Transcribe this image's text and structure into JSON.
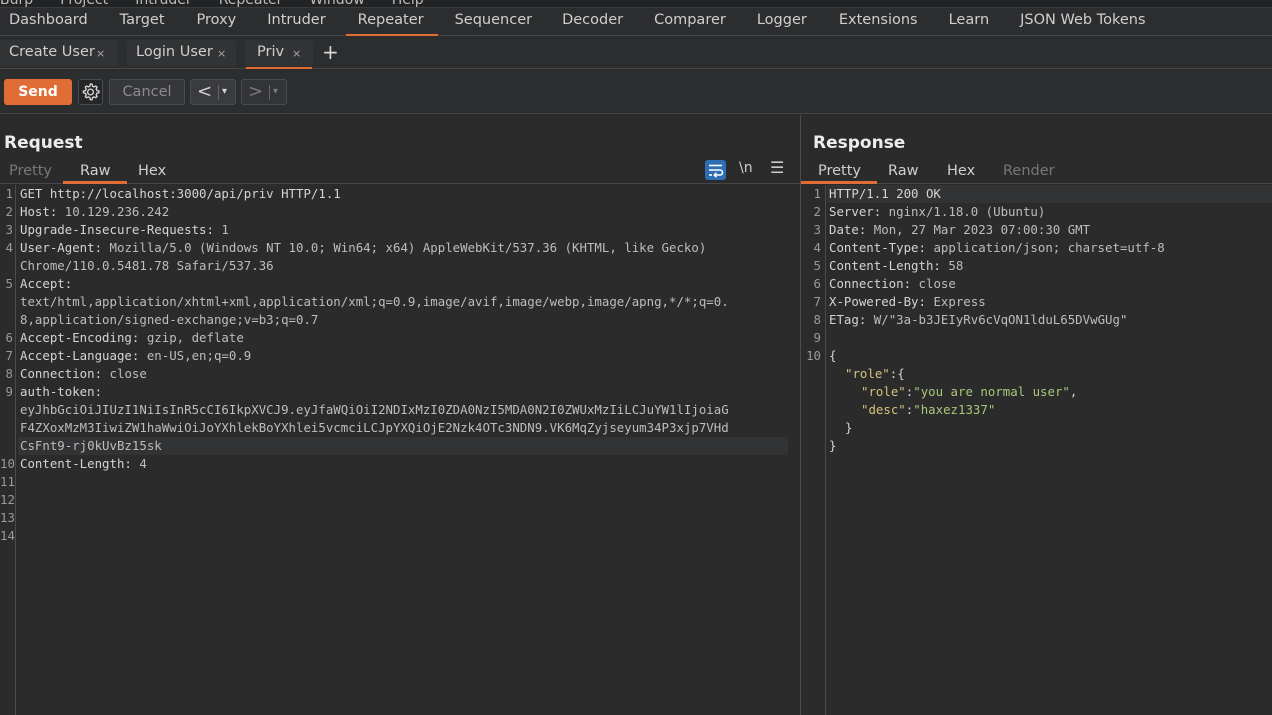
{
  "menubar": {
    "items": [
      "Burp",
      "Project",
      "Intruder",
      "Repeater",
      "Window",
      "Help"
    ]
  },
  "main_tabs": [
    {
      "label": "Dashboard",
      "active": false
    },
    {
      "label": "Target",
      "active": false
    },
    {
      "label": "Proxy",
      "active": false
    },
    {
      "label": "Intruder",
      "active": false
    },
    {
      "label": "Repeater",
      "active": true
    },
    {
      "label": "Sequencer",
      "active": false
    },
    {
      "label": "Decoder",
      "active": false
    },
    {
      "label": "Comparer",
      "active": false
    },
    {
      "label": "Logger",
      "active": false
    },
    {
      "label": "Extensions",
      "active": false
    },
    {
      "label": "Learn",
      "active": false
    },
    {
      "label": "JSON Web Tokens",
      "active": false
    }
  ],
  "repeater_tabs": [
    {
      "label": "Create User",
      "close": "×",
      "active": false
    },
    {
      "label": "Login User",
      "close": "×",
      "active": false
    },
    {
      "label": "Priv",
      "close": "×",
      "active": true
    }
  ],
  "add_tab_label": "+",
  "toolbar": {
    "send_label": "Send",
    "cancel_label": "Cancel",
    "settings_icon": "gear-icon",
    "prev_label": "<",
    "next_label": ">",
    "dropdown_glyph": "▾"
  },
  "request": {
    "title": "Request",
    "tabs": [
      {
        "label": "Pretty",
        "state": "disabled"
      },
      {
        "label": "Raw",
        "state": "active"
      },
      {
        "label": "Hex",
        "state": "normal"
      }
    ],
    "tools": {
      "wrap_icon": "word-wrap-icon",
      "newline_label": "\\n",
      "menu_icon": "hamburger-menu-icon"
    },
    "lines": [
      {
        "n": "1",
        "text": "GET http://localhost:3000/api/priv HTTP/1.1"
      },
      {
        "n": "2",
        "key": "Host:",
        "val": " 10.129.236.242"
      },
      {
        "n": "3",
        "key": "Upgrade-Insecure-Requests:",
        "val": " 1"
      },
      {
        "n": "4",
        "key": "User-Agent:",
        "val": " Mozilla/5.0 (Windows NT 10.0; Win64; x64) AppleWebKit/537.36 (KHTML, like Gecko)"
      },
      {
        "n": "",
        "val": "Chrome/110.0.5481.78 Safari/537.36"
      },
      {
        "n": "5",
        "key": "Accept:",
        "val": ""
      },
      {
        "n": "",
        "val": "text/html,application/xhtml+xml,application/xml;q=0.9,image/avif,image/webp,image/apng,*/*;q=0."
      },
      {
        "n": "",
        "val": "8,application/signed-exchange;v=b3;q=0.7"
      },
      {
        "n": "6",
        "key": "Accept-Encoding:",
        "val": " gzip, deflate"
      },
      {
        "n": "7",
        "key": "Accept-Language:",
        "val": " en-US,en;q=0.9"
      },
      {
        "n": "8",
        "key": "Connection:",
        "val": " close"
      },
      {
        "n": "9",
        "key": "auth-token:",
        "val": ""
      },
      {
        "n": "",
        "val": "eyJhbGciOiJIUzI1NiIsInR5cCI6IkpXVCJ9.eyJfaWQiOiI2NDIxMzI0ZDA0NzI5MDA0N2I0ZWUxMzIiLCJuYW1lIjoiaG"
      },
      {
        "n": "",
        "val": "F4ZXoxMzM3IiwiZW1haWwiOiJoYXhlekBoYXhlei5vcmciLCJpYXQiOjE2Nzk4OTc3NDN9.VK6MqZyjseyum34P3xjp7VHd"
      },
      {
        "n": "",
        "val": "CsFnt9-rj0kUvBz15sk",
        "highlight": true
      },
      {
        "n": "10",
        "key": "Content-Length:",
        "val": " 4"
      },
      {
        "n": "11",
        "val": ""
      },
      {
        "n": "12",
        "val": ""
      },
      {
        "n": "13",
        "val": ""
      },
      {
        "n": "14",
        "val": ""
      }
    ]
  },
  "response": {
    "title": "Response",
    "tabs": [
      {
        "label": "Pretty",
        "state": "active"
      },
      {
        "label": "Raw",
        "state": "normal"
      },
      {
        "label": "Hex",
        "state": "normal"
      },
      {
        "label": "Render",
        "state": "disabled"
      }
    ],
    "lines": [
      {
        "n": "1",
        "text": "HTTP/1.1 200 OK",
        "highlight": true
      },
      {
        "n": "2",
        "key": "Server:",
        "val": " nginx/1.18.0 (Ubuntu)"
      },
      {
        "n": "3",
        "key": "Date:",
        "val": " Mon, 27 Mar 2023 07:00:30 GMT"
      },
      {
        "n": "4",
        "key": "Content-Type:",
        "val": " application/json; charset=utf-8"
      },
      {
        "n": "5",
        "key": "Content-Length:",
        "val": " 58"
      },
      {
        "n": "6",
        "key": "Connection:",
        "val": " close"
      },
      {
        "n": "7",
        "key": "X-Powered-By:",
        "val": " Express"
      },
      {
        "n": "8",
        "key": "ETag:",
        "val": " W/\"3a-b3JEIyRv6cVqON1lduL65DVwGUg\""
      },
      {
        "n": "9",
        "text": ""
      },
      {
        "n": "10",
        "text": "{"
      }
    ],
    "json_body": {
      "outer_key": "\"role\"",
      "outer_open": ":{",
      "inner": [
        {
          "key": "\"role\"",
          "value": "\"you are normal user\"",
          "trail": ","
        },
        {
          "key": "\"desc\"",
          "value": "\"haxez1337\"",
          "trail": ""
        }
      ],
      "inner_close": "}",
      "outer_close": "}"
    }
  },
  "colors": {
    "accent": "#e06d36",
    "background": "#2b2b2b",
    "wrap_toggle_active": "#2f6db5",
    "json_key": "#d3c27a",
    "json_string": "#a9c77a"
  }
}
